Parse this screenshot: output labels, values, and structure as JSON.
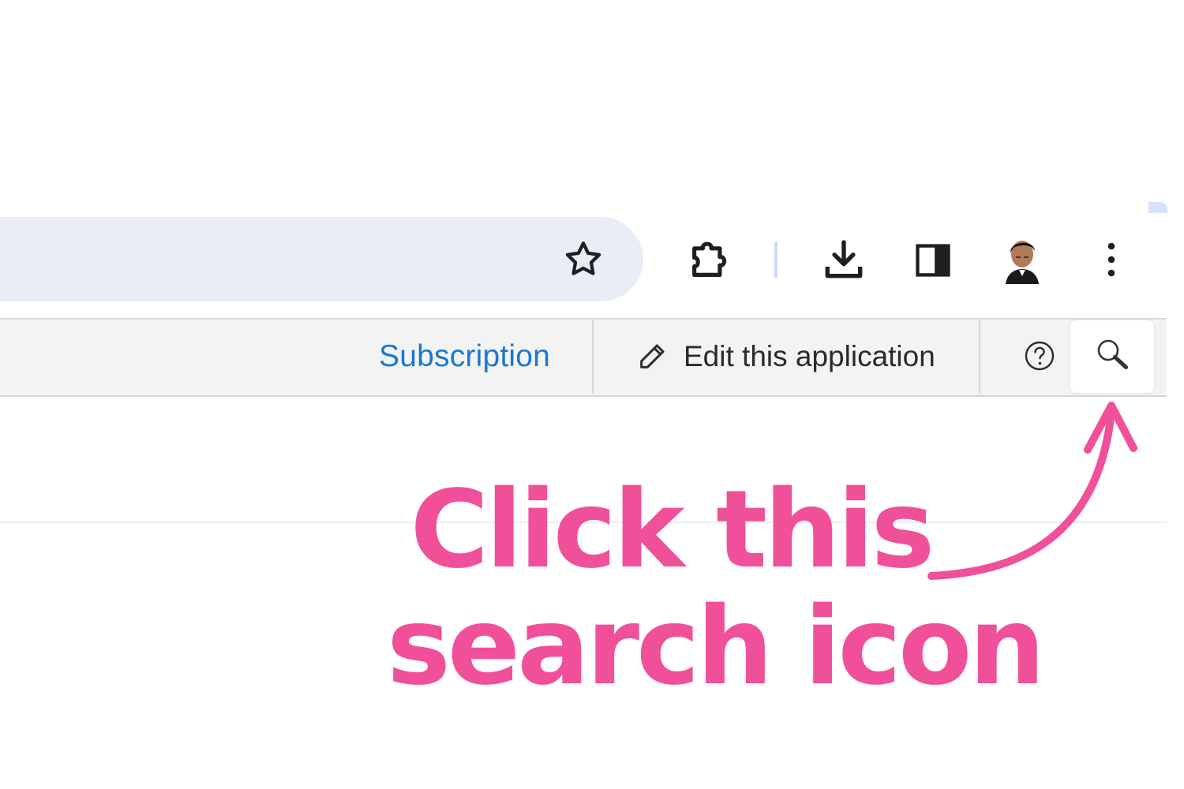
{
  "browser_toolbar": {
    "bookmark_icon": "star-icon",
    "extensions_icon": "puzzle-piece-icon",
    "downloads_icon": "download-icon",
    "side_panel_icon": "side-panel-icon",
    "profile_avatar": "profile-photo",
    "menu_icon": "three-dots-vertical-icon",
    "colors": {
      "omnibox_bg": "#e9eef6",
      "icon": "#1f1f1f",
      "divider": "#c7dcfb"
    }
  },
  "app_header": {
    "subscription_link": "Subscription",
    "edit_application_label": "Edit this application",
    "edit_icon": "pencil-icon",
    "help_icon": "question-circle-icon",
    "search_icon": "magnifier-icon",
    "colors": {
      "link": "#1a78d2",
      "background": "#f3f3f3"
    }
  },
  "annotation": {
    "line1": "Click this",
    "line2": "search icon",
    "arrow_icon": "curved-arrow-icon",
    "color": "#f0509a"
  }
}
